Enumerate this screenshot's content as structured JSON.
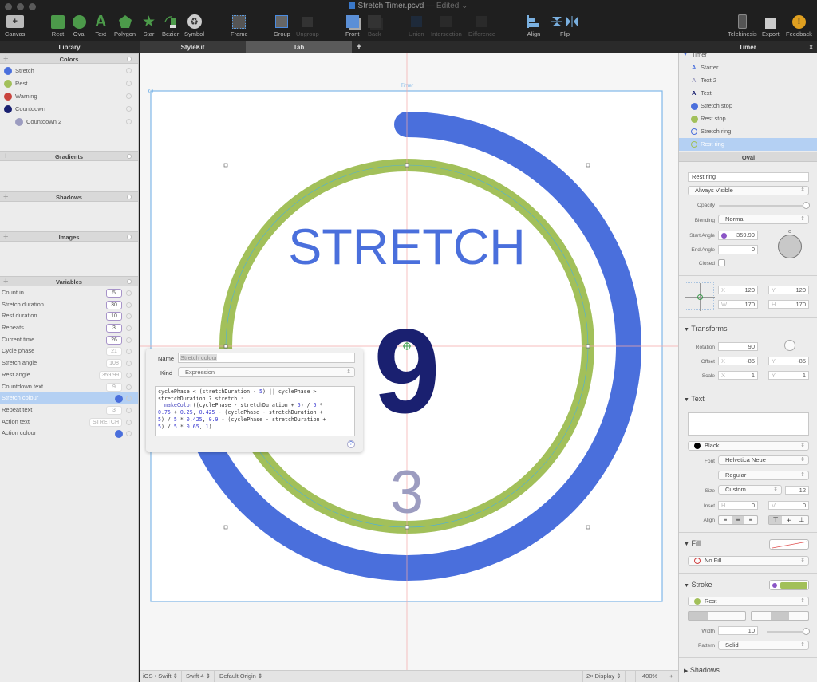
{
  "window": {
    "title": "Stretch Timer.pcvd",
    "edited": "— Edited ⌄"
  },
  "toolbar": {
    "canvas": "Canvas",
    "rect": "Rect",
    "oval": "Oval",
    "text": "Text",
    "polygon": "Polygon",
    "star": "Star",
    "bezier": "Bezier",
    "symbol": "Symbol",
    "frame": "Frame",
    "group": "Group",
    "ungroup": "Ungroup",
    "front": "Front",
    "back": "Back",
    "union": "Union",
    "intersection": "Intersection",
    "difference": "Difference",
    "align": "Align",
    "flip": "Flip",
    "telekinesis": "Telekinesis",
    "export": "Export",
    "feedback": "Feedback"
  },
  "tabs": {
    "library": "Library",
    "stylekit": "StyleKit",
    "tab": "Tab",
    "add": "+",
    "inspector_title": "Timer"
  },
  "library": {
    "colors_header": "Colors",
    "colors": [
      {
        "name": "Stretch",
        "hex": "#4a6fdc"
      },
      {
        "name": "Rest",
        "hex": "#a2c05a"
      },
      {
        "name": "Warning",
        "hex": "#c9443e"
      },
      {
        "name": "Countdown",
        "hex": "#1a2070"
      },
      {
        "name": "Countdown 2",
        "hex": "#9c9cc0"
      }
    ],
    "gradients_header": "Gradients",
    "shadows_header": "Shadows",
    "images_header": "Images",
    "variables_header": "Variables",
    "variables": [
      {
        "name": "Count in",
        "value": "5",
        "kind": "edit"
      },
      {
        "name": "Stretch duration",
        "value": "30",
        "kind": "edit"
      },
      {
        "name": "Rest duration",
        "value": "10",
        "kind": "edit"
      },
      {
        "name": "Repeats",
        "value": "3",
        "kind": "edit"
      },
      {
        "name": "Current time",
        "value": "26",
        "kind": "edit"
      },
      {
        "name": "Cycle phase",
        "value": "21",
        "kind": "ro"
      },
      {
        "name": "Stretch angle",
        "value": "108",
        "kind": "ro"
      },
      {
        "name": "Rest angle",
        "value": "359.99",
        "kind": "ro"
      },
      {
        "name": "Countdown text",
        "value": "9",
        "kind": "ro"
      },
      {
        "name": "Stretch colour",
        "value": null,
        "kind": "color",
        "hex": "#4a6fdc"
      },
      {
        "name": "Repeat text",
        "value": "3",
        "kind": "ro"
      },
      {
        "name": "Action text",
        "value": "STRETCH",
        "kind": "ro"
      },
      {
        "name": "Action colour",
        "value": null,
        "kind": "color",
        "hex": "#4a6fdc"
      }
    ]
  },
  "popover": {
    "name_label": "Name",
    "name_value": "Stretch colour",
    "kind_label": "Kind",
    "kind_value": "Expression",
    "expression": "cyclePhase < (stretchDuration - 5) || cyclePhase >\nstretchDuration ? stretch :\n  makeColor((cyclePhase - stretchDuration + 5) / 5 *\n0.75 + 0.25, 0.425 - (cyclePhase - stretchDuration +\n5) / 5 * 0.425, 0.9 - (cyclePhase - stretchDuration +\n5) / 5 * 0.65, 1)",
    "help": "?"
  },
  "canvas": {
    "frame_label": "Timer",
    "action_text": "STRETCH",
    "countdown_text": "9",
    "repeat_text": "3",
    "stretch_angle_deg": 108,
    "colors": {
      "stretch": "#4a6fdc",
      "rest": "#a2c05a",
      "countdown": "#1a2070",
      "countdown2": "#9c9cc0"
    }
  },
  "statusbar": {
    "platform": "iOS • Swift ⇕",
    "swift": "Swift 4 ⇕",
    "origin": "Default Origin ⇕",
    "display": "2× Display ⇕",
    "minus": "−",
    "zoom": "400%",
    "plus": "+"
  },
  "inspector": {
    "tree": [
      {
        "name": "Timer",
        "icon": "group"
      },
      {
        "name": "Starter",
        "icon": "text",
        "color": "#4a6fdc"
      },
      {
        "name": "Text 2",
        "icon": "text",
        "color": "#9c9cc0"
      },
      {
        "name": "Text",
        "icon": "text",
        "color": "#1a2070"
      },
      {
        "name": "Stretch stop",
        "icon": "oval",
        "color": "#4a6fdc"
      },
      {
        "name": "Rest stop",
        "icon": "oval",
        "color": "#a2c05a"
      },
      {
        "name": "Stretch ring",
        "icon": "ring",
        "color": "#4a6fdc"
      },
      {
        "name": "Rest ring",
        "icon": "ring",
        "color": "#a2c05a"
      }
    ],
    "section_title": "Oval",
    "name_value": "Rest ring",
    "visibility": "Always Visible",
    "opacity_label": "Opacity",
    "opacity": 1.0,
    "blending_label": "Blending",
    "blending": "Normal",
    "start_angle_label": "Start Angle",
    "start_angle": "359.99",
    "end_angle_label": "End Angle",
    "end_angle": "0",
    "closed_label": "Closed",
    "x": "120",
    "y": "120",
    "w": "170",
    "h": "170",
    "x_lbl": "X",
    "y_lbl": "Y",
    "w_lbl": "W",
    "h_lbl": "H",
    "transforms_title": "Transforms",
    "rotation_label": "Rotation",
    "rotation": "90",
    "offset_label": "Offset",
    "offset_x": "-85",
    "offset_y": "-85",
    "scale_label": "Scale",
    "scale_x": "1",
    "scale_y": "1",
    "text_title": "Text",
    "text_color": "Black",
    "font_label": "Font",
    "font": "Helvetica Neue",
    "font_style": "Regular",
    "size_label": "Size",
    "size_mode": "Custom",
    "size": "12",
    "inset_label": "Inset",
    "inset_h": "0",
    "inset_v": "0",
    "v_lbl": "V",
    "align_label": "Align",
    "fill_title": "Fill",
    "fill": "No Fill",
    "stroke_title": "Stroke",
    "stroke_color": "Rest",
    "stroke_hex": "#a2c05a",
    "width_label": "Width",
    "width": "10",
    "pattern_label": "Pattern",
    "pattern": "Solid",
    "shadows_title": "Shadows"
  }
}
